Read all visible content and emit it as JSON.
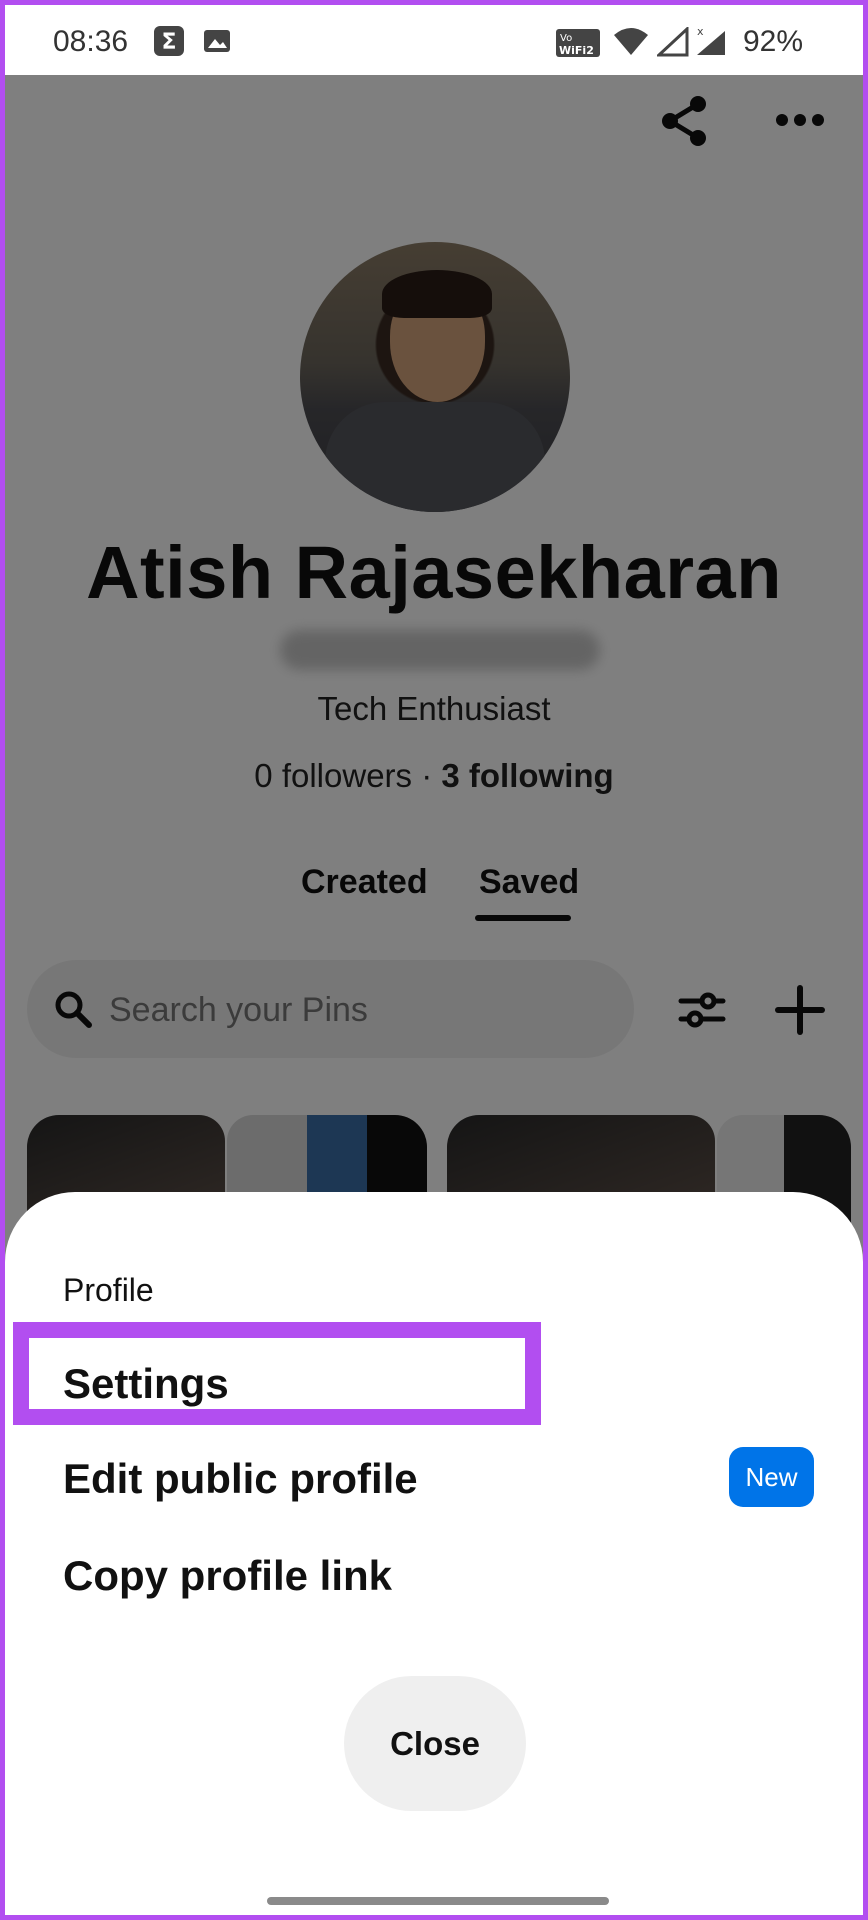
{
  "status_bar": {
    "time": "08:36",
    "battery": "92%",
    "icons": [
      "sigma-icon",
      "gallery-icon",
      "vowifi-icon",
      "wifi-icon",
      "signal-icon",
      "signal-x-icon"
    ],
    "vowifi_text": "Vo WiFi 2"
  },
  "header": {
    "icons": [
      "share-icon",
      "more-icon"
    ]
  },
  "profile": {
    "name": "Atish Rajasekharan",
    "bio": "Tech Enthusiast",
    "followers": "0 followers",
    "separator": " · ",
    "following": "3 following"
  },
  "tabs": [
    {
      "label": "Created",
      "selected": false
    },
    {
      "label": "Saved",
      "selected": true
    }
  ],
  "search": {
    "placeholder": "Search your Pins"
  },
  "toolbar_icons": [
    "filter-icon",
    "plus-icon"
  ],
  "sheet": {
    "header": "Profile",
    "items": [
      {
        "label": "Settings",
        "highlighted": true
      },
      {
        "label": "Edit public profile",
        "badge": "New"
      },
      {
        "label": "Copy profile link"
      }
    ],
    "close_label": "Close"
  },
  "colors": {
    "highlight": "#b24ef0",
    "badge": "#0074e8",
    "overlay": "rgba(0,0,0,0.5)"
  }
}
